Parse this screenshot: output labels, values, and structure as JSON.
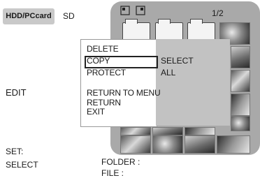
{
  "tabs": {
    "active": "HDD/PCcard",
    "inactive": "SD"
  },
  "left_pane": {
    "mode_label": "EDIT",
    "set_label": "SET:",
    "select_label": "SELECT"
  },
  "header": {
    "mode_icons": "card-icon, card-icon",
    "page": "1/2"
  },
  "menu": {
    "items": [
      "DELETE",
      "COPY",
      "PROTECT",
      "RETURN TO MENU",
      "RETURN",
      "EXIT"
    ],
    "selected": "COPY"
  },
  "submenu": {
    "items": [
      "SELECT",
      "ALL"
    ]
  },
  "info": {
    "folder_label": "FOLDER :",
    "file_label": "FILE :"
  }
}
